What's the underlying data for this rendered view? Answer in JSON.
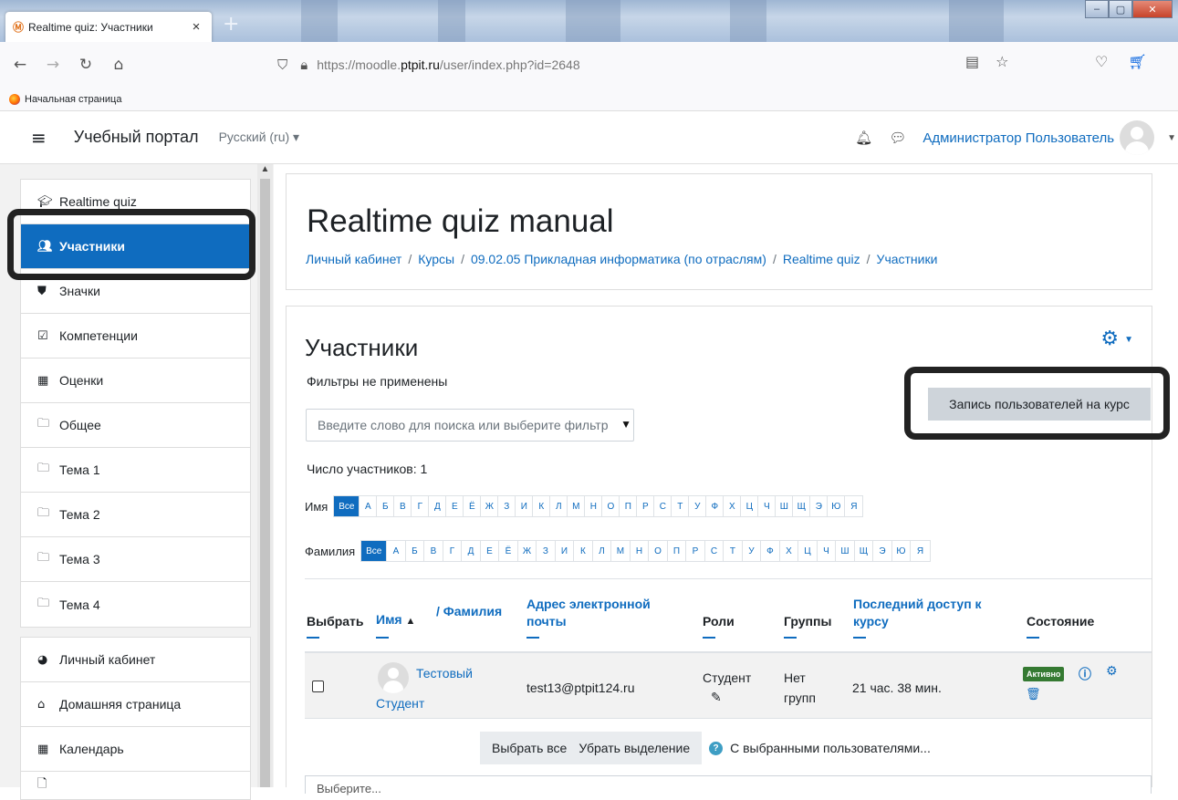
{
  "browser": {
    "tab_title": "Realtime quiz: Участники",
    "tab_close": "×",
    "new_tab": "+",
    "url_prefix": "https://moodle.",
    "url_domain": "ptpit.ru",
    "url_path": "/user/index.php?id=2648",
    "bookmark": "Начальная страница"
  },
  "topnav": {
    "site_name": "Учебный портал",
    "language": "Русский (ru) ▾",
    "user_name": "Администратор Пользователь"
  },
  "sidebar": {
    "course_items": [
      {
        "label": "Realtime quiz",
        "icon": "graduation-cap-icon"
      },
      {
        "label": "Участники",
        "icon": "users-icon"
      },
      {
        "label": "Значки",
        "icon": "shield-icon"
      },
      {
        "label": "Компетенции",
        "icon": "check-square-icon"
      },
      {
        "label": "Оценки",
        "icon": "table-icon"
      },
      {
        "label": "Общее",
        "icon": "folder-icon"
      },
      {
        "label": "Тема 1",
        "icon": "folder-icon"
      },
      {
        "label": "Тема 2",
        "icon": "folder-icon"
      },
      {
        "label": "Тема 3",
        "icon": "folder-icon"
      },
      {
        "label": "Тема 4",
        "icon": "folder-icon"
      }
    ],
    "site_items": [
      {
        "label": "Личный кабинет",
        "icon": "dashboard-icon"
      },
      {
        "label": "Домашняя страница",
        "icon": "home-icon"
      },
      {
        "label": "Календарь",
        "icon": "calendar-icon"
      }
    ]
  },
  "header": {
    "title": "Realtime quiz manual",
    "breadcrumb": [
      "Личный кабинет",
      "Курсы",
      "09.02.05 Прикладная информатика (по отраслям)",
      "Realtime quiz",
      "Участники"
    ],
    "separator": "/"
  },
  "participants": {
    "title": "Участники",
    "filters_status": "Фильтры не применены",
    "enrol_button": "Запись пользователей на курс",
    "search_placeholder": "Введите слово для поиска или выберите фильтр",
    "count": "Число участников: 1",
    "firstname_label": "Имя",
    "lastname_label": "Фамилия",
    "all_label": "Все",
    "letters": [
      "А",
      "Б",
      "В",
      "Г",
      "Д",
      "Е",
      "Ё",
      "Ж",
      "З",
      "И",
      "К",
      "Л",
      "М",
      "Н",
      "О",
      "П",
      "Р",
      "С",
      "Т",
      "У",
      "Ф",
      "Х",
      "Ц",
      "Ч",
      "Ш",
      "Щ",
      "Э",
      "Ю",
      "Я"
    ]
  },
  "table": {
    "headers": {
      "select": "Выбрать",
      "firstname": "Имя",
      "sort_arrow": "▲",
      "lastname": "/ Фамилия",
      "email_1": "Адрес электронной",
      "email_2": "почты",
      "roles": "Роли",
      "groups": "Группы",
      "lastaccess_1": "Последний доступ к",
      "lastaccess_2": "курсу",
      "status": "Состояние"
    },
    "row": {
      "firstname": "Тестовый",
      "lastname": "Студент",
      "email": "test13@ptpit124.ru",
      "role": "Студент",
      "groups_1": "Нет",
      "groups_2": "групп",
      "last_access": "21 час. 38 мин.",
      "status": "Активно"
    }
  },
  "bulk": {
    "select_all": "Выбрать все",
    "deselect": "Убрать выделение",
    "help": "?",
    "with_selected": "С выбранными пользователями..."
  },
  "bottom_select": "Выберите..."
}
